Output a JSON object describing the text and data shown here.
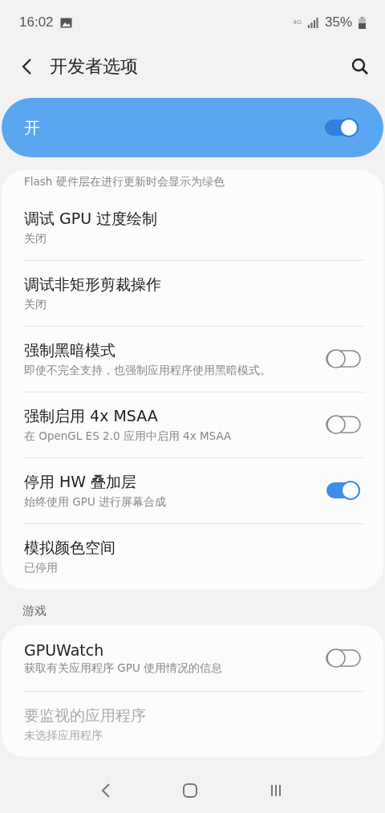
{
  "status_bar": {
    "time": "16:02",
    "network": "4G",
    "battery": "35%"
  },
  "header": {
    "title": "开发者选项"
  },
  "master_switch": {
    "label": "开",
    "on": true
  },
  "groups": [
    {
      "items": [
        {
          "kind": "note",
          "subtitle": "Flash 硬件层在进行更新时会显示为绿色"
        },
        {
          "kind": "text",
          "title": "调试 GPU 过度绘制",
          "subtitle": "关闭",
          "disabled": false
        },
        {
          "kind": "text",
          "title": "调试非矩形剪裁操作",
          "subtitle": "关闭",
          "disabled": false
        },
        {
          "kind": "switch",
          "title": "强制黑暗模式",
          "subtitle": "即使不完全支持，也强制应用程序使用黑暗模式。",
          "on": false,
          "disabled": false
        },
        {
          "kind": "switch",
          "title": "强制启用 4x MSAA",
          "subtitle": "在 OpenGL ES 2.0 应用中启用 4x MSAA",
          "on": false,
          "disabled": false
        },
        {
          "kind": "switch",
          "title": "停用 HW 叠加层",
          "subtitle": "始终使用 GPU 进行屏幕合成",
          "on": true,
          "disabled": false
        },
        {
          "kind": "text",
          "title": "模拟颜色空间",
          "subtitle": "已停用",
          "disabled": false
        }
      ]
    },
    {
      "heading": "游戏",
      "items": [
        {
          "kind": "switch",
          "title": "GPUWatch",
          "subtitle": "获取有关应用程序 GPU 使用情况的信息",
          "on": false,
          "disabled": false
        },
        {
          "kind": "text",
          "title": "要监视的应用程序",
          "subtitle": "未选择应用程序",
          "disabled": true
        }
      ]
    }
  ]
}
